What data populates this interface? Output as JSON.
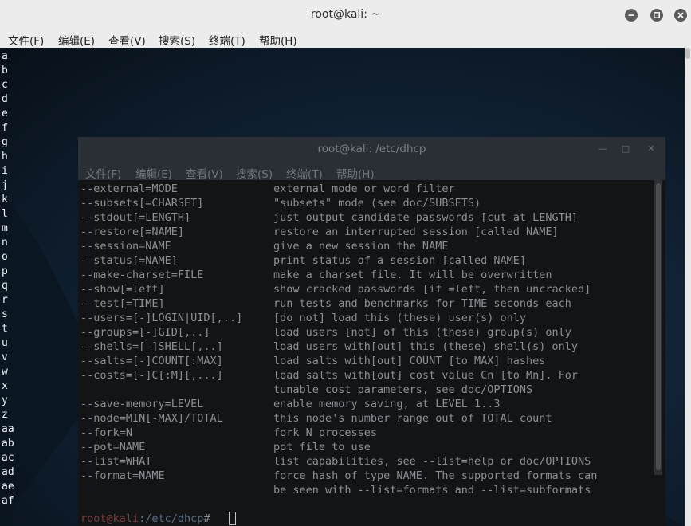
{
  "window": {
    "title": "root@kali: ~",
    "menu": [
      "文件(F)",
      "编辑(E)",
      "查看(V)",
      "搜索(S)",
      "终端(T)",
      "帮助(H)"
    ]
  },
  "terminal_lines": [
    "a",
    "b",
    "c",
    "d",
    "e",
    "f",
    "g",
    "h",
    "i",
    "j",
    "k",
    "l",
    "m",
    "n",
    "o",
    "p",
    "q",
    "r",
    "s",
    "t",
    "u",
    "v",
    "w",
    "x",
    "y",
    "z",
    "aa",
    "ab",
    "ac",
    "ad",
    "ae",
    "af"
  ],
  "inner_window": {
    "title": "root@kali: /etc/dhcp",
    "menu": [
      "文件(F)",
      "编辑(E)",
      "查看(V)",
      "搜索(S)",
      "终端(T)",
      "帮助(H)"
    ],
    "options": [
      {
        "flag": "--external=MODE",
        "desc": "external mode or word filter"
      },
      {
        "flag": "--subsets[=CHARSET]",
        "desc": "\"subsets\" mode (see doc/SUBSETS)"
      },
      {
        "flag": "--stdout[=LENGTH]",
        "desc": "just output candidate passwords [cut at LENGTH]"
      },
      {
        "flag": "--restore[=NAME]",
        "desc": "restore an interrupted session [called NAME]"
      },
      {
        "flag": "--session=NAME",
        "desc": "give a new session the NAME"
      },
      {
        "flag": "--status[=NAME]",
        "desc": "print status of a session [called NAME]"
      },
      {
        "flag": "--make-charset=FILE",
        "desc": "make a charset file. It will be overwritten"
      },
      {
        "flag": "--show[=left]",
        "desc": "show cracked passwords [if =left, then uncracked]"
      },
      {
        "flag": "--test[=TIME]",
        "desc": "run tests and benchmarks for TIME seconds each"
      },
      {
        "flag": "--users=[-]LOGIN|UID[,..]",
        "desc": "[do not] load this (these) user(s) only"
      },
      {
        "flag": "--groups=[-]GID[,..]",
        "desc": "load users [not] of this (these) group(s) only"
      },
      {
        "flag": "--shells=[-]SHELL[,..]",
        "desc": "load users with[out] this (these) shell(s) only"
      },
      {
        "flag": "--salts=[-]COUNT[:MAX]",
        "desc": "load salts with[out] COUNT [to MAX] hashes"
      },
      {
        "flag": "--costs=[-]C[:M][,...]",
        "desc": "load salts with[out] cost value Cn [to Mn]. For"
      },
      {
        "flag": "",
        "desc": "tunable cost parameters, see doc/OPTIONS"
      },
      {
        "flag": "--save-memory=LEVEL",
        "desc": "enable memory saving, at LEVEL 1..3"
      },
      {
        "flag": "--node=MIN[-MAX]/TOTAL",
        "desc": "this node's number range out of TOTAL count"
      },
      {
        "flag": "--fork=N",
        "desc": "fork N processes"
      },
      {
        "flag": "--pot=NAME",
        "desc": "pot file to use"
      },
      {
        "flag": "--list=WHAT",
        "desc": "list capabilities, see --list=help or doc/OPTIONS"
      },
      {
        "flag": "--format=NAME",
        "desc": "force hash of type NAME. The supported formats can"
      },
      {
        "flag": "",
        "desc": "be seen with --list=formats and --list=subformats"
      }
    ],
    "prompt": {
      "user": "root@kali",
      "path": ":/etc/dhcp",
      "symbol": "# "
    }
  },
  "icons": {
    "minimize": "minimize-icon",
    "maximize": "maximize-icon",
    "close": "close-icon"
  },
  "colors": {
    "prompt_user": "#7a3a3a",
    "prompt_path": "#5c6e86",
    "titlebar": "#ececec"
  }
}
